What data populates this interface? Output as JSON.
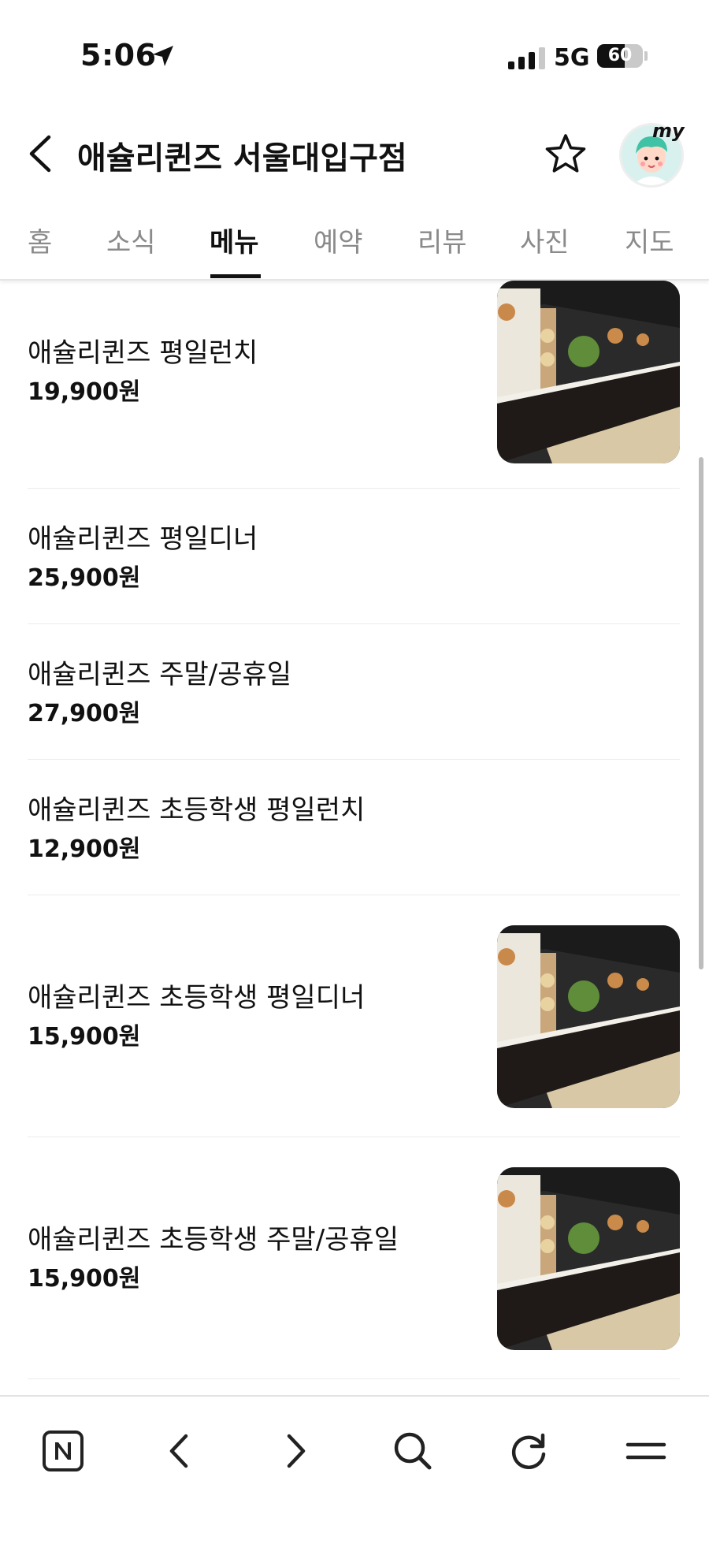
{
  "status_bar": {
    "time": "5:06",
    "network": "5G",
    "battery": "60",
    "battery_level": 0.6
  },
  "header": {
    "title": "애슐리퀸즈 서울대입구점",
    "avatar_badge": "my",
    "icons": [
      "back-icon",
      "star-icon",
      "avatar"
    ]
  },
  "tabs": [
    {
      "label": "홈",
      "active": false
    },
    {
      "label": "소식",
      "active": false
    },
    {
      "label": "메뉴",
      "active": true
    },
    {
      "label": "예약",
      "active": false
    },
    {
      "label": "리뷰",
      "active": false
    },
    {
      "label": "사진",
      "active": false
    },
    {
      "label": "지도",
      "active": false
    }
  ],
  "menu_items": [
    {
      "name": "애슐리퀸즈 평일런치",
      "price": "19,900원",
      "has_image": true
    },
    {
      "name": "애슐리퀸즈 평일디너",
      "price": "25,900원",
      "has_image": false
    },
    {
      "name": "애슐리퀸즈 주말/공휴일",
      "price": "27,900원",
      "has_image": false
    },
    {
      "name": "애슐리퀸즈 초등학생 평일런치",
      "price": "12,900원",
      "has_image": false
    },
    {
      "name": "애슐리퀸즈 초등학생 평일디너",
      "price": "15,900원",
      "has_image": true
    },
    {
      "name": "애슐리퀸즈 초등학생 주말/공휴일",
      "price": "15,900원",
      "has_image": true
    }
  ],
  "toolbar": {
    "icons": [
      "naver-home-icon",
      "back-arrow-icon",
      "forward-arrow-icon",
      "search-icon",
      "refresh-icon",
      "menu-icon"
    ]
  },
  "colors": {
    "text": "#111111",
    "tab_inactive": "#8a8a8a",
    "divider": "#ececec"
  }
}
